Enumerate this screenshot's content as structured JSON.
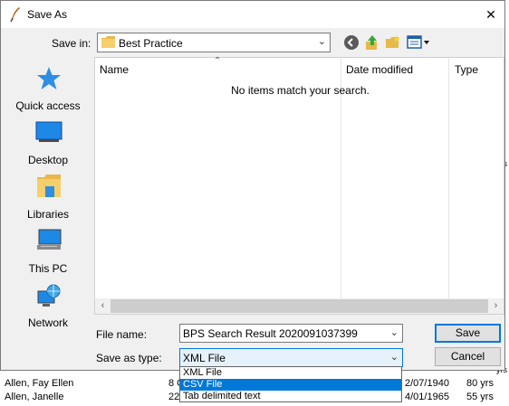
{
  "dialog": {
    "title": "Save As",
    "close_glyph": "✕",
    "save_in_label": "Save in:",
    "save_in_value": "Best Practice",
    "toolbar_icons": [
      "back-icon",
      "up-folder-icon",
      "new-folder-icon",
      "view-menu-icon"
    ]
  },
  "places": [
    {
      "label": "Quick access",
      "icon": "star-icon"
    },
    {
      "label": "Desktop",
      "icon": "desktop-icon"
    },
    {
      "label": "Libraries",
      "icon": "libraries-icon"
    },
    {
      "label": "This PC",
      "icon": "computer-icon"
    },
    {
      "label": "Network",
      "icon": "network-icon"
    }
  ],
  "listview": {
    "columns": [
      "Name",
      "Date modified",
      "Type"
    ],
    "empty_message": "No items match your search."
  },
  "fields": {
    "file_name_label": "File name:",
    "file_name_value": "BPS Search Result 2020091037399",
    "save_type_label": "Save as type:",
    "save_type_value": "XML File"
  },
  "buttons": {
    "save": "Save",
    "cancel": "Cancel"
  },
  "dropdown": {
    "options": [
      "XML File",
      "CSV File",
      "Tab delimited text"
    ],
    "selected_index": 1
  },
  "background_rows": [
    {
      "name": "Allen, Fay Ellen",
      "mid": "8 G",
      "date": "2/07/1940",
      "age": "80 yrs"
    },
    {
      "name": "Allen, Janelle",
      "mid": "22",
      "date": "4/01/1965",
      "age": "55 yrs"
    }
  ],
  "background_partial": [
    "yrs",
    "yrs"
  ],
  "colors": {
    "accent": "#0078d7",
    "dialog_bg": "#f0f0f0",
    "selection": "#0078d7"
  }
}
